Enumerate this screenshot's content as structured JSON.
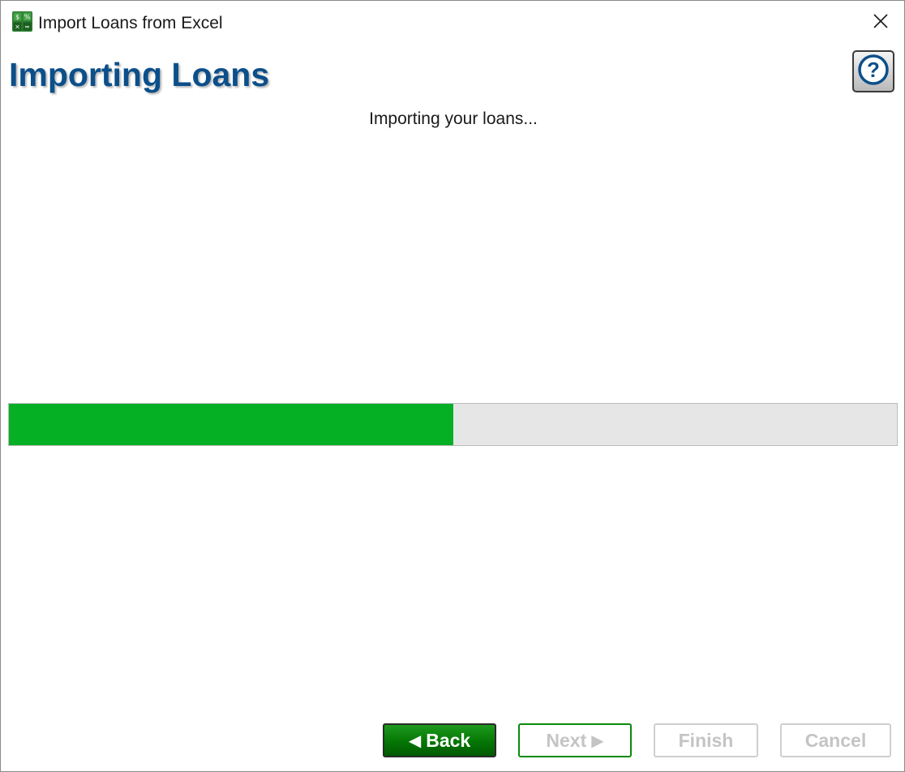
{
  "window": {
    "title": "Import Loans from Excel",
    "icon": "calculator-icon"
  },
  "header": {
    "title": "Importing Loans",
    "help_label": "?"
  },
  "status": {
    "message": "Importing your loans..."
  },
  "progress": {
    "fraction": 0.5,
    "fill_color": "#06b025",
    "track_color": "#e6e6e6"
  },
  "buttons": {
    "back_label": "Back",
    "back_arrow": "◀",
    "next_label": "Next",
    "next_arrow": "▶",
    "finish_label": "Finish",
    "cancel_label": "Cancel"
  },
  "colors": {
    "title_blue": "#0c4f8a",
    "back_green": "#047604"
  }
}
